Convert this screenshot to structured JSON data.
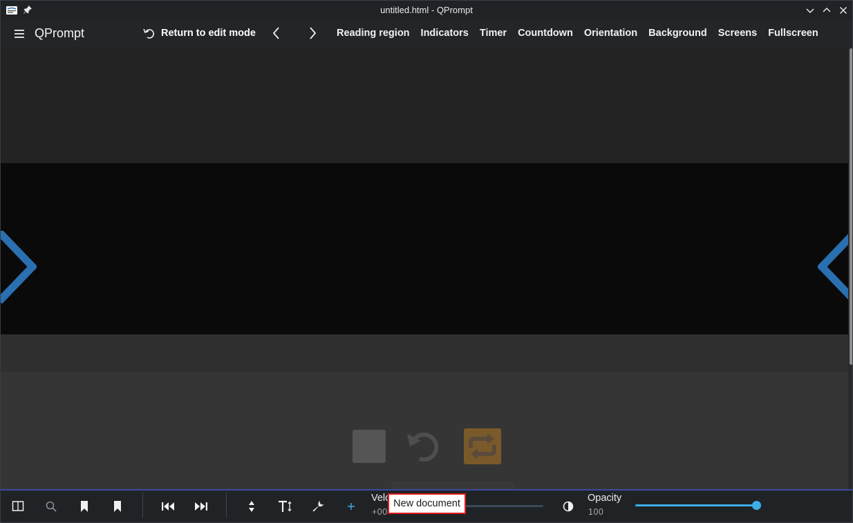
{
  "window": {
    "title": "untitled.html - QPrompt",
    "app_icon": "qprompt-logo-icon",
    "pin_icon": "pin-icon",
    "controls": [
      "minimize-icon",
      "maximize-icon",
      "close-icon"
    ]
  },
  "toolbar": {
    "menu_icon": "hamburger-menu-icon",
    "brand": "QPrompt",
    "return_label": "Return to edit mode",
    "return_icon": "undo-arrow-icon",
    "prev_icon": "chevron-left-icon",
    "next_icon": "chevron-right-icon",
    "menu_items": [
      "Reading region",
      "Indicators",
      "Timer",
      "Countdown",
      "Orientation",
      "Background",
      "Screens",
      "Fullscreen"
    ]
  },
  "prompter": {
    "pointer_color": "#2a6fb0",
    "reading_region_color": "#0a0a0a",
    "faded_icons": [
      "stop-square-icon",
      "rewind-circle-icon",
      "loop-icon"
    ]
  },
  "bottom_bar": {
    "accent": "#3daee9",
    "left_icons": [
      "split-view-icon",
      "search-icon",
      "bookmark-icon",
      "bookmark-icon"
    ],
    "nav_icons": [
      "skip-to-start-icon",
      "skip-to-end-icon"
    ],
    "tool_icons": [
      "up-down-arrows-icon",
      "font-size-icon",
      "wrench-icon",
      "plus-icon"
    ],
    "velocity": {
      "label": "Velo",
      "value": "+00"
    },
    "contrast_icon": "contrast-icon",
    "opacity": {
      "label": "Opacity",
      "value": "100",
      "level": 1.0
    },
    "tooltip": "New document"
  }
}
